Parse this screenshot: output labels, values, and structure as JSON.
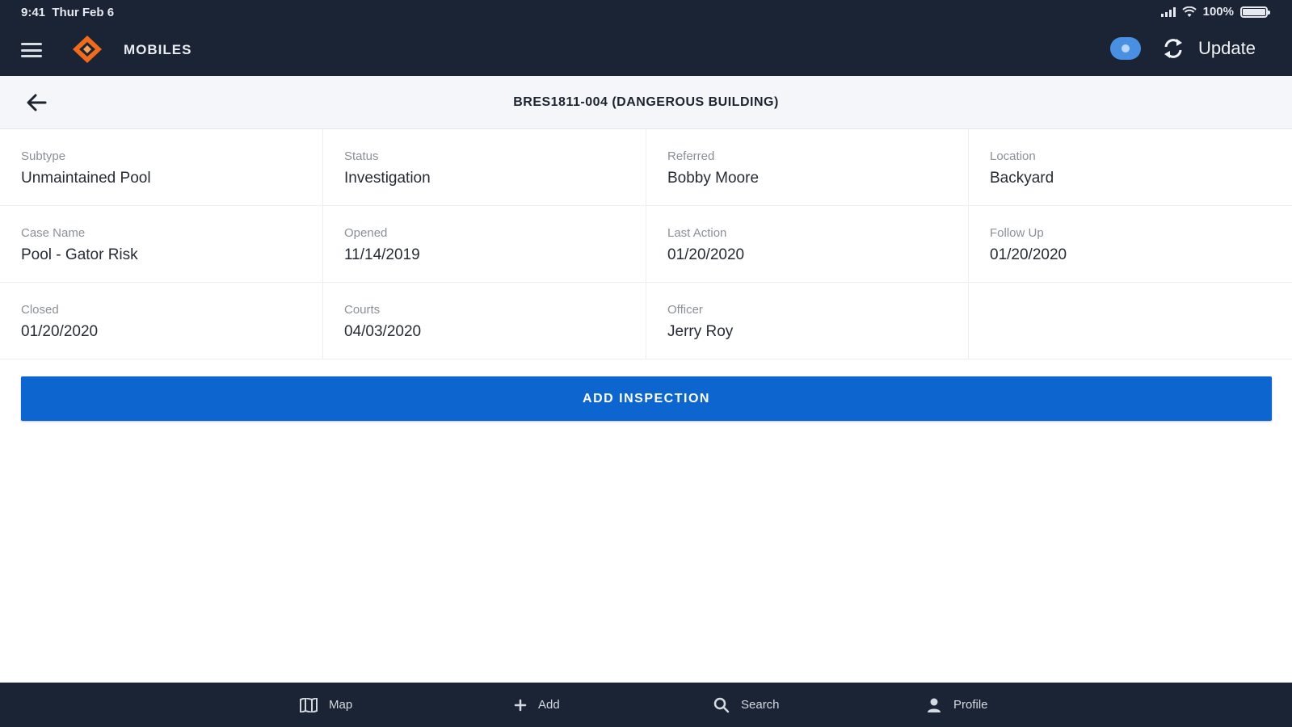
{
  "status_bar": {
    "time": "9:41",
    "date": "Thur Feb 6",
    "battery": "100%"
  },
  "header": {
    "app_name": "MOBILES",
    "update_label": "Update"
  },
  "page": {
    "title": "BRES1811-004 (DANGEROUS BUILDING)"
  },
  "details": [
    {
      "label": "Subtype",
      "value": "Unmaintained Pool"
    },
    {
      "label": "Status",
      "value": "Investigation"
    },
    {
      "label": "Referred",
      "value": "Bobby Moore"
    },
    {
      "label": "Location",
      "value": "Backyard"
    },
    {
      "label": "Case Name",
      "value": "Pool - Gator Risk"
    },
    {
      "label": "Opened",
      "value": "11/14/2019"
    },
    {
      "label": "Last Action",
      "value": "01/20/2020"
    },
    {
      "label": "Follow Up",
      "value": "01/20/2020"
    },
    {
      "label": "Closed",
      "value": "01/20/2020"
    },
    {
      "label": "Courts",
      "value": "04/03/2020"
    },
    {
      "label": "Officer",
      "value": "Jerry Roy"
    },
    {
      "label": "",
      "value": ""
    }
  ],
  "actions": {
    "add_inspection": "ADD INSPECTION"
  },
  "tabs": [
    {
      "label": "Map",
      "icon": "map-icon"
    },
    {
      "label": "Add",
      "icon": "plus-icon"
    },
    {
      "label": "Search",
      "icon": "search-icon"
    },
    {
      "label": "Profile",
      "icon": "person-icon"
    }
  ],
  "colors": {
    "nav_background": "#1b2434",
    "primary_button": "#0d66d0",
    "brand_orange": "#f26b1d",
    "badge_blue": "#4a90e2"
  }
}
